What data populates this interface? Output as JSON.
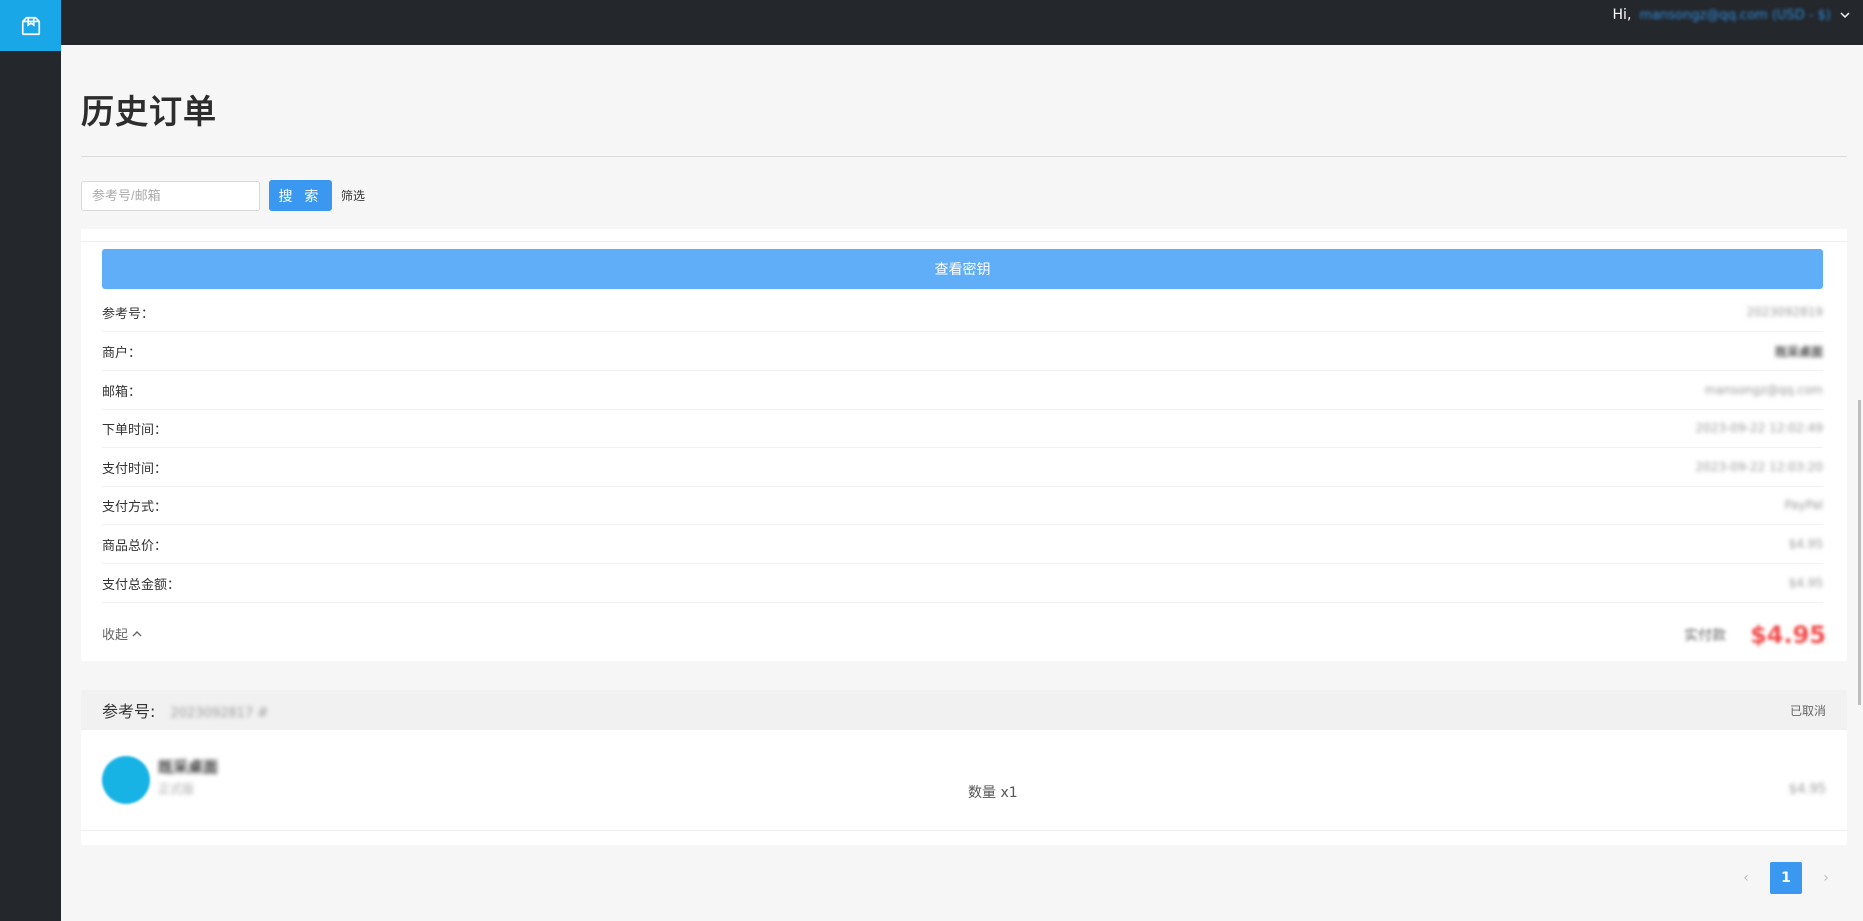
{
  "header": {
    "greeting": "Hi,",
    "user_email": "mansongz@qq.com (USD - $)"
  },
  "page": {
    "title": "历史订单"
  },
  "search": {
    "placeholder": "参考号/邮箱",
    "button_label": "搜 索",
    "filter_label": "筛选"
  },
  "order1": {
    "view_key_label": "查看密钥",
    "details": [
      {
        "label": "参考号：",
        "value": "2023092819"
      },
      {
        "label": "商户：",
        "value": "既采桌面"
      },
      {
        "label": "邮箱：",
        "value": "mansongz@qq.com"
      },
      {
        "label": "下单时间：",
        "value": "2023-09-22 12:02:49"
      },
      {
        "label": "支付时间：",
        "value": "2023-09-22 12:03:20"
      },
      {
        "label": "支付方式：",
        "value": "PayPal"
      },
      {
        "label": "商品总价：",
        "value": "$4.95"
      },
      {
        "label": "支付总金额：",
        "value": "$4.95"
      }
    ],
    "collapse_label": "收起",
    "paid_label": "实付款",
    "paid_amount": "$4.95"
  },
  "order2": {
    "ref_label": "参考号:",
    "ref_number": "2023092817 #",
    "status": "已取消",
    "item_name": "既采桌面",
    "item_sub": "正式版",
    "quantity": "数量 x1",
    "price": "$4.95"
  },
  "pagination": {
    "prev": "‹",
    "current": "1",
    "next": "›"
  },
  "colors": {
    "accent": "#3a98f0",
    "sidebar": "#24272b",
    "logo_bg": "#1aa7e8",
    "price_red": "#f24a4a"
  }
}
